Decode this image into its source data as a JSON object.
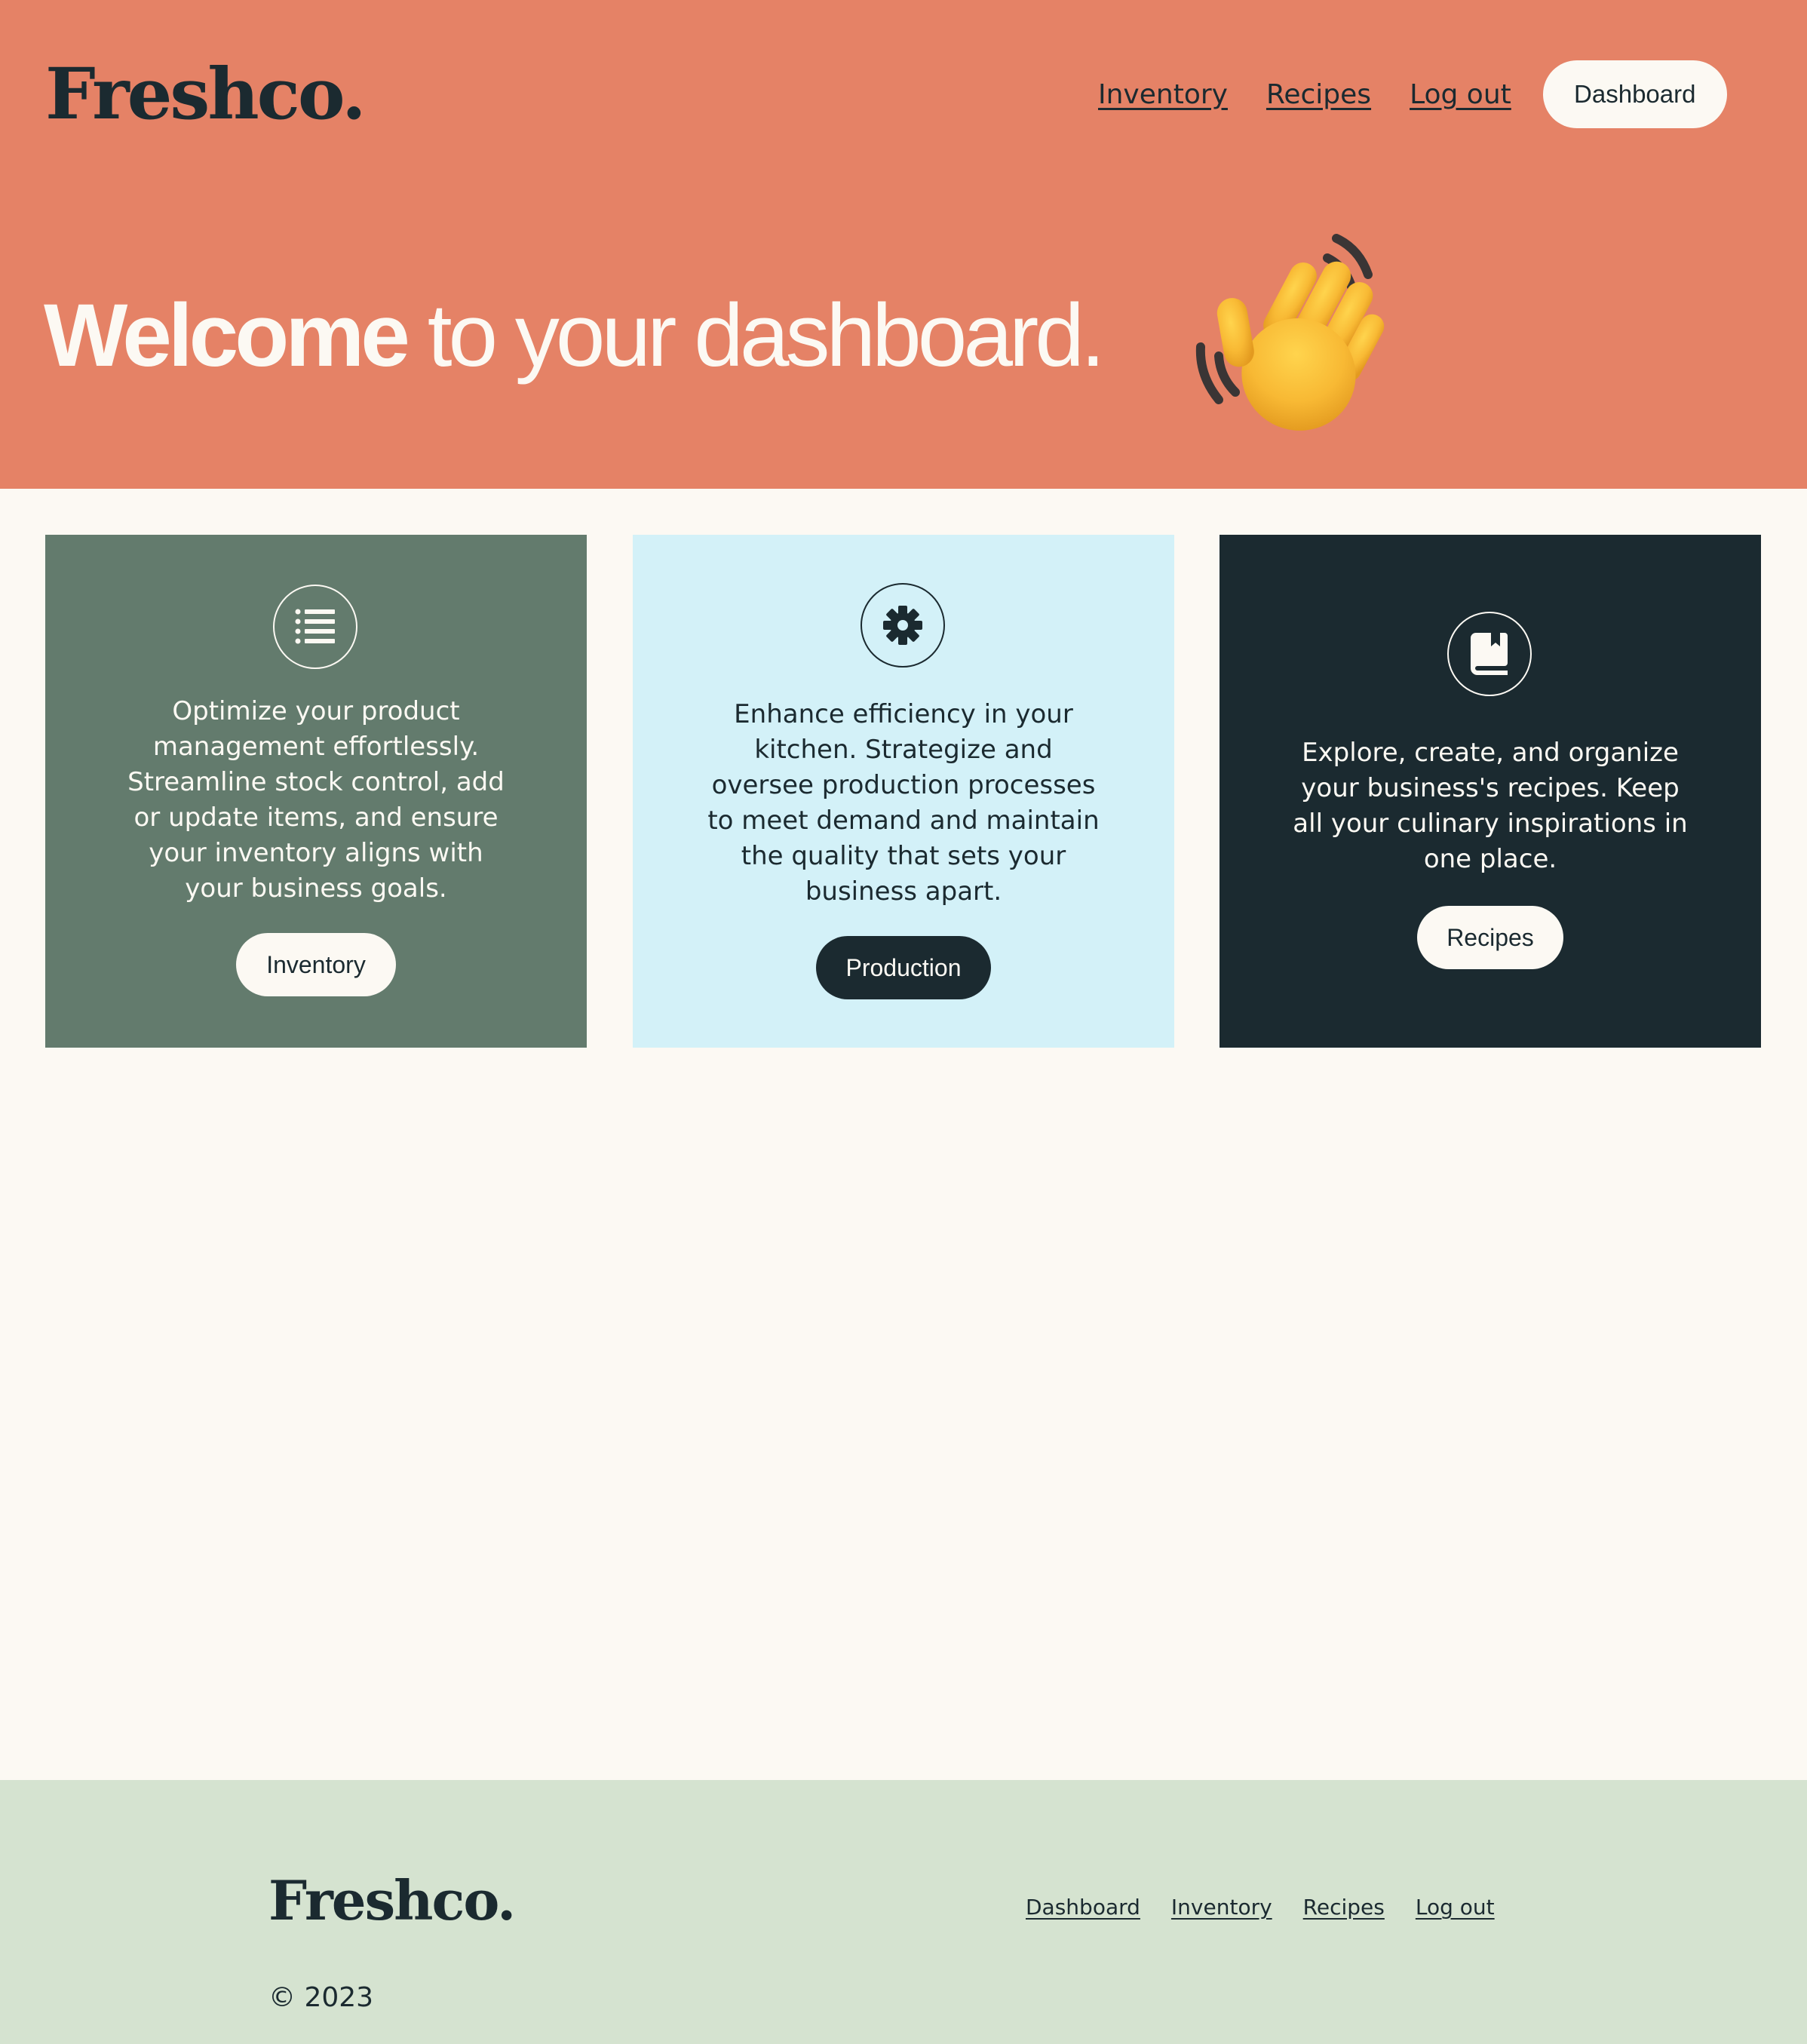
{
  "brand": {
    "name": "Freshco."
  },
  "nav": {
    "links": [
      "Inventory",
      "Recipes",
      "Log out"
    ],
    "dashboard_button": "Dashboard"
  },
  "hero": {
    "title_bold": "Welcome",
    "title_rest": " to your dashboard.",
    "emoji": "waving-hand"
  },
  "cards": [
    {
      "icon": "list-icon",
      "text": "Optimize your product management effortlessly. Streamline stock control, add or update items, and ensure your inventory aligns with your business goals.",
      "button": "Inventory",
      "background": "#637b6d"
    },
    {
      "icon": "gear-icon",
      "text": "Enhance efficiency in your kitchen. Strategize and oversee production processes to meet demand and maintain the quality that sets your business apart.",
      "button": "Production",
      "background": "#d3f1f8"
    },
    {
      "icon": "book-icon",
      "text": "Explore, create, and organize your business's recipes. Keep all your culinary inspirations in one place.",
      "button": "Recipes",
      "background": "#1b2a30"
    }
  ],
  "footer": {
    "brand": "Freshco.",
    "links": [
      "Dashboard",
      "Inventory",
      "Recipes",
      "Log out"
    ],
    "copyright": "© 2023"
  },
  "colors": {
    "hero_bg": "#e58266",
    "page_bg": "#fcf9f3",
    "footer_bg": "#d5e3d0",
    "dark": "#1b2a30"
  }
}
